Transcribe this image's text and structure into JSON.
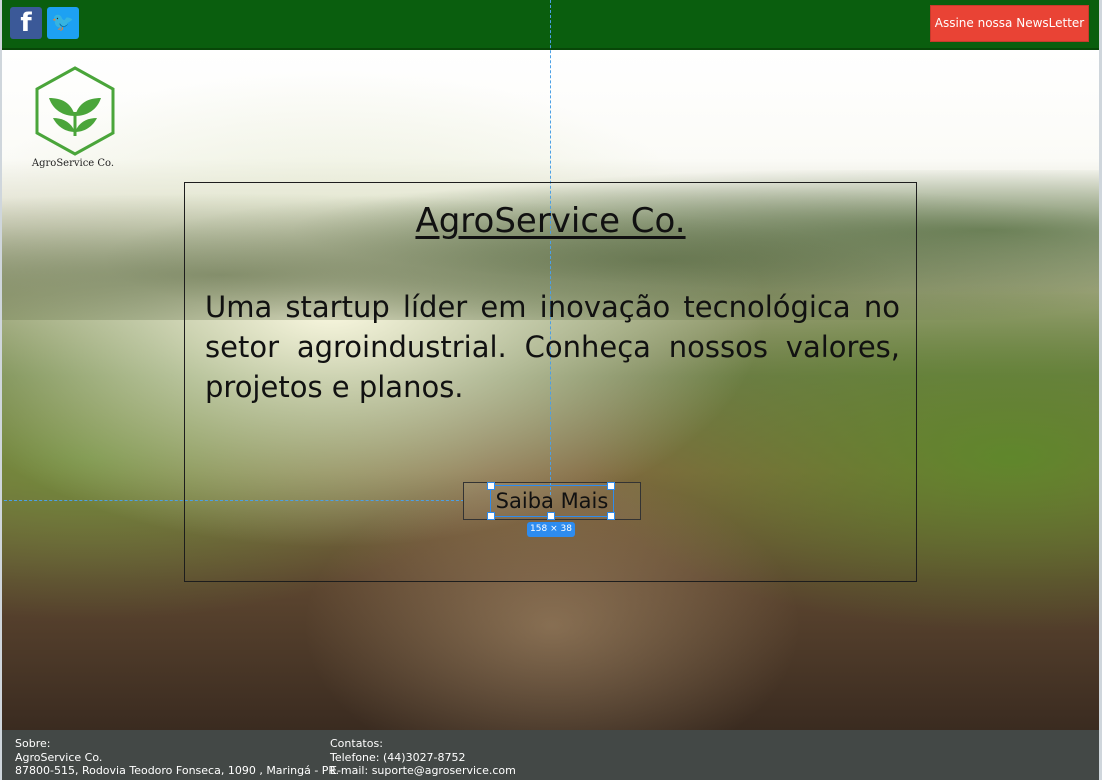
{
  "header": {
    "social": [
      {
        "name": "facebook",
        "glyph": "f",
        "icon": "facebook-icon",
        "color": "#3b5998"
      },
      {
        "name": "twitter",
        "glyph": "🐦",
        "icon": "twitter-icon",
        "color": "#1da1f2"
      }
    ],
    "newsletter_label": "Assine nossa NewsLetter",
    "colors": {
      "bar": "#0a5e0e",
      "newsletter": "#e94335"
    }
  },
  "logo": {
    "text": "AgroService Co.",
    "color": "#4aa53a"
  },
  "hero": {
    "title": "AgroService Co.",
    "description": "Uma startup líder em inovação tecnológica no setor agroindustrial. Conheça nossos valores, projetos e planos.",
    "cta_label": "Saiba Mais",
    "selection_size": "158 × 38"
  },
  "footer": {
    "about_label": "Sobre:",
    "about_company": "AgroService Co.",
    "about_address": "87800-515, Rodovia Teodoro Fonseca, 1090 , Maringá - PR.",
    "contacts_label": "Contatos:",
    "phone": "Telefone: (44)3027-8752",
    "email": "E-mail: suporte@agroservice.com",
    "color": "#434846"
  }
}
